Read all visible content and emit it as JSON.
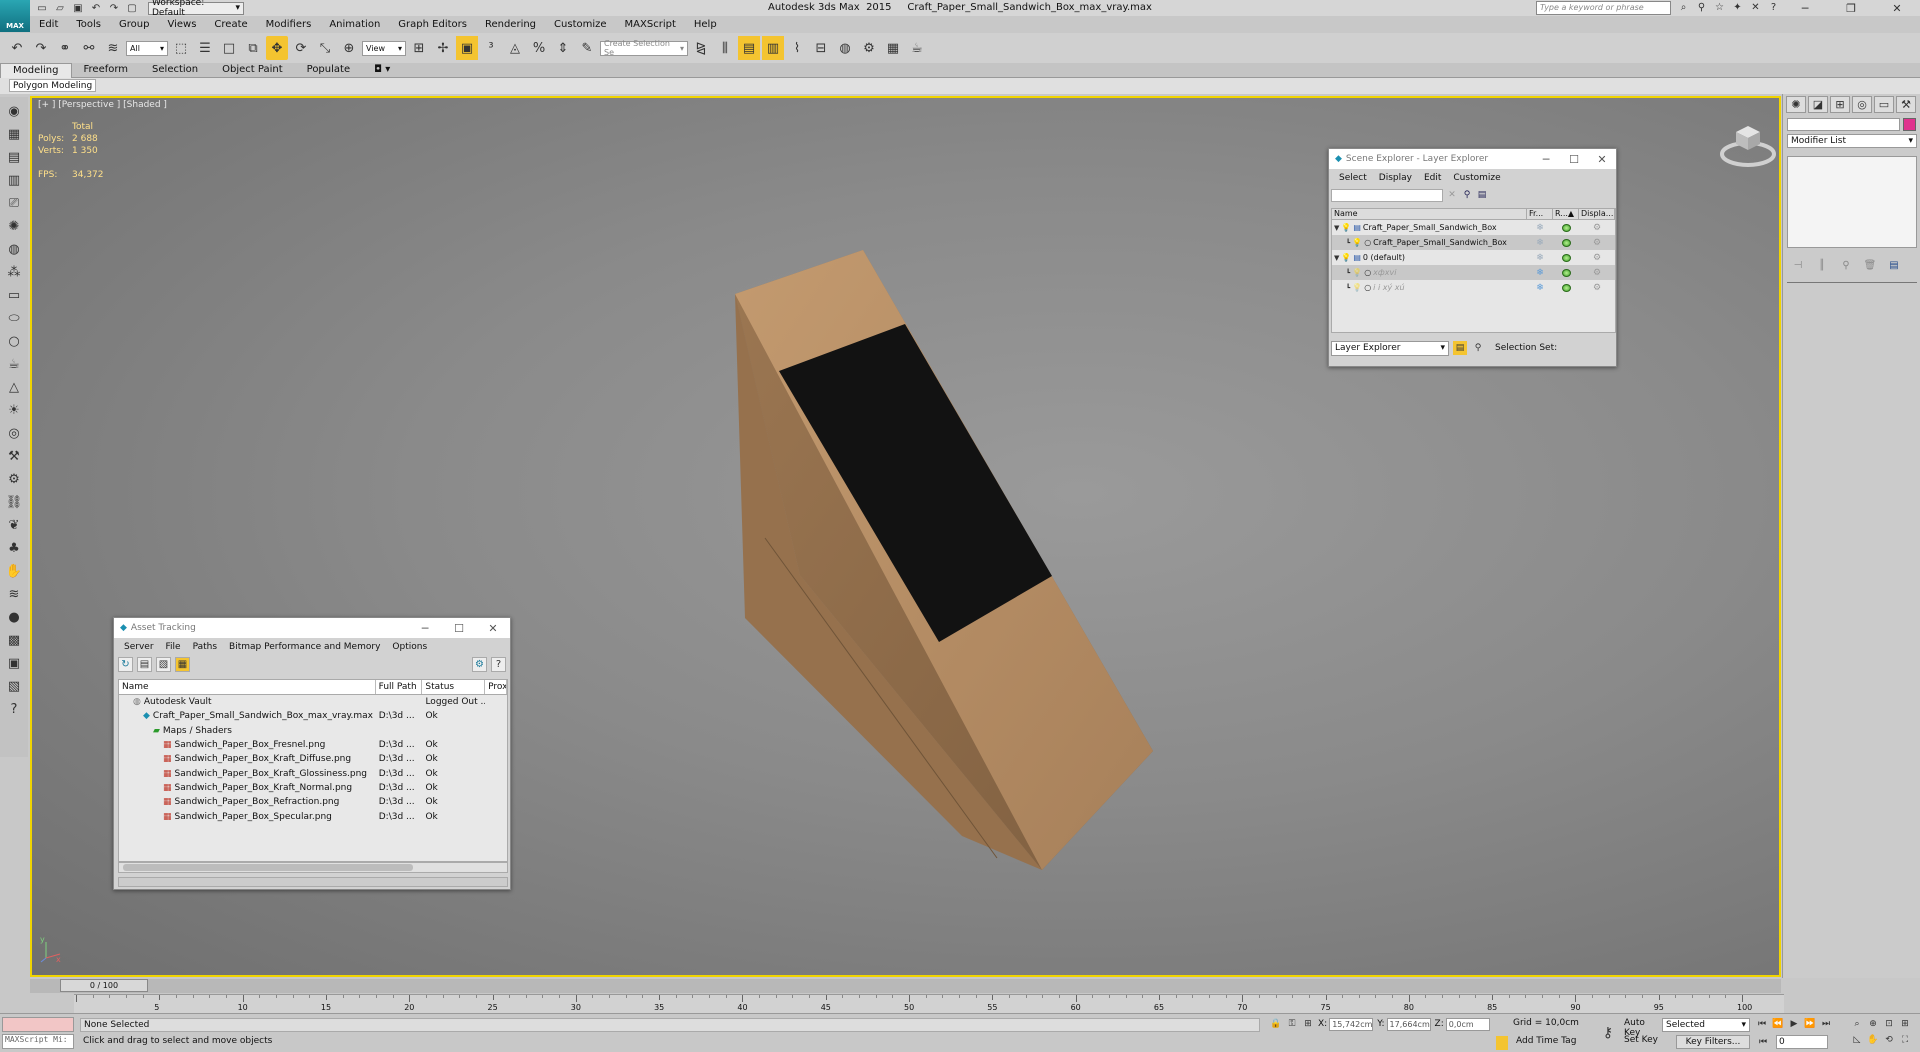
{
  "app": {
    "logo": "MAX",
    "title": "Autodesk 3ds Max  2015     Craft_Paper_Small_Sandwich_Box_max_vray.max",
    "workspace": "Workspace: Default",
    "search_placeholder": "Type a keyword or phrase"
  },
  "menu": [
    "Edit",
    "Tools",
    "Group",
    "Views",
    "Create",
    "Modifiers",
    "Animation",
    "Graph Editors",
    "Rendering",
    "Customize",
    "MAXScript",
    "Help"
  ],
  "toolbar": {
    "filter": "All",
    "ref_coord": "View",
    "selection_set": "Create Selection Se"
  },
  "ribbon": {
    "tabs": [
      "Modeling",
      "Freeform",
      "Selection",
      "Object Paint",
      "Populate"
    ],
    "active_tab": "Modeling",
    "panel_label": "Polygon Modeling"
  },
  "viewport": {
    "label": "[+ ] [Perspective ] [Shaded ]",
    "stats": {
      "header": "Total",
      "polys_label": "Polys:",
      "polys": "2 688",
      "verts_label": "Verts:",
      "verts": "1 350",
      "fps_label": "FPS:",
      "fps": "34,372"
    }
  },
  "command_panel": {
    "modifier_list": "Modifier List"
  },
  "scene_explorer": {
    "title": "Scene Explorer - Layer Explorer",
    "menu": [
      "Select",
      "Display",
      "Edit",
      "Customize"
    ],
    "columns": [
      "Name",
      "Fr...",
      "R...▲",
      "Displa..."
    ],
    "rows": [
      {
        "name": "Craft_Paper_Small_Sandwich_Box",
        "indent": 0,
        "type": "layer",
        "selected": false,
        "hidden": false
      },
      {
        "name": "Craft_Paper_Small_Sandwich_Box",
        "indent": 1,
        "type": "object",
        "selected": true,
        "hidden": false
      },
      {
        "name": "0 (default)",
        "indent": 0,
        "type": "layer",
        "selected": false,
        "hidden": false
      },
      {
        "name": "xфxvi",
        "indent": 1,
        "type": "object",
        "selected": true,
        "hidden": true
      },
      {
        "name": "i i xý xú",
        "indent": 1,
        "type": "object",
        "selected": false,
        "hidden": true
      }
    ],
    "explorer_dd": "Layer Explorer",
    "selection_set_label": "Selection Set:"
  },
  "asset_tracking": {
    "title": "Asset Tracking",
    "menu": [
      "Server",
      "File",
      "Paths",
      "Bitmap Performance and Memory",
      "Options"
    ],
    "columns": [
      "Name",
      "Full Path",
      "Status",
      "Prox"
    ],
    "rows": [
      {
        "name": "Autodesk Vault",
        "path": "",
        "status": "Logged Out ...",
        "indent": 1,
        "icon": "vault"
      },
      {
        "name": "Craft_Paper_Small_Sandwich_Box_max_vray.max",
        "path": "D:\\3d ...",
        "status": "Ok",
        "indent": 2,
        "icon": "max"
      },
      {
        "name": "Maps / Shaders",
        "path": "",
        "status": "",
        "indent": 3,
        "icon": "folder"
      },
      {
        "name": "Sandwich_Paper_Box_Fresnel.png",
        "path": "D:\\3d ...",
        "status": "Ok",
        "indent": 4,
        "icon": "image"
      },
      {
        "name": "Sandwich_Paper_Box_Kraft_Diffuse.png",
        "path": "D:\\3d ...",
        "status": "Ok",
        "indent": 4,
        "icon": "image"
      },
      {
        "name": "Sandwich_Paper_Box_Kraft_Glossiness.png",
        "path": "D:\\3d ...",
        "status": "Ok",
        "indent": 4,
        "icon": "image"
      },
      {
        "name": "Sandwich_Paper_Box_Kraft_Normal.png",
        "path": "D:\\3d ...",
        "status": "Ok",
        "indent": 4,
        "icon": "image"
      },
      {
        "name": "Sandwich_Paper_Box_Refraction.png",
        "path": "D:\\3d ...",
        "status": "Ok",
        "indent": 4,
        "icon": "image"
      },
      {
        "name": "Sandwich_Paper_Box_Specular.png",
        "path": "D:\\3d ...",
        "status": "Ok",
        "indent": 4,
        "icon": "image"
      }
    ]
  },
  "timeline": {
    "slider": "0 / 100",
    "ticks": [
      0,
      5,
      10,
      15,
      20,
      25,
      30,
      35,
      40,
      45,
      50,
      55,
      60,
      65,
      70,
      75,
      80,
      85,
      90,
      95,
      100
    ]
  },
  "status": {
    "maxscript": "MAXScript Mi:",
    "selection": "None Selected",
    "prompt": "Click and drag to select and move objects",
    "x_label": "X:",
    "x": "15,742cm",
    "y_label": "Y:",
    "y": "17,664cm",
    "z_label": "Z:",
    "z": "0,0cm",
    "grid": "Grid = 10,0cm",
    "add_time_tag": "Add Time Tag",
    "auto_key": "Auto Key",
    "set_key": "Set Key",
    "key_mode": "Selected",
    "key_filters": "Key Filters...",
    "frame": "0"
  },
  "colors": {
    "viewport_border": "#f0d400",
    "stats_text": "#ffe08a",
    "box_front": "#b08a63",
    "box_side": "#8e6c4b",
    "window_panel": "#111111"
  }
}
